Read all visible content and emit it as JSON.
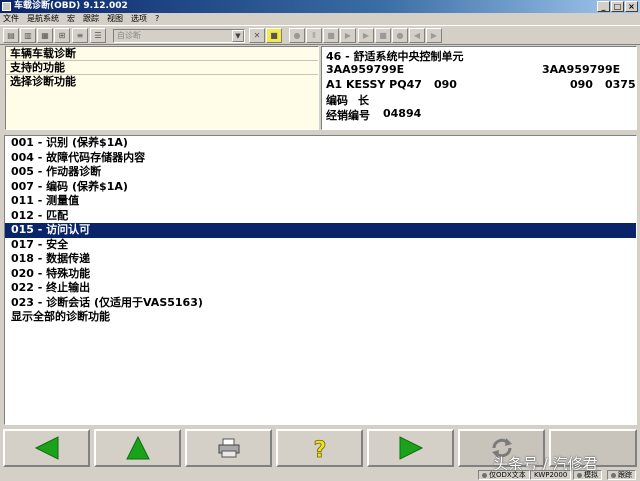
{
  "window": {
    "title": "车载诊断(OBD) 9.12.002"
  },
  "menu": [
    "文件",
    "是航系统",
    "宏",
    "跟踪",
    "视图",
    "选项",
    "?"
  ],
  "toolbar": {
    "combo_value": "自诊断"
  },
  "nav": {
    "items": [
      {
        "label": "车辆车载诊断"
      },
      {
        "label": "支持的功能"
      },
      {
        "label": "选择诊断功能"
      }
    ]
  },
  "ecu_info": {
    "title": "46 - 舒适系统中央控制单元",
    "part_left": "3AA959799E",
    "part_right": "3AA959799E",
    "component": "A1 KESSY PQ47",
    "sw_left": "090",
    "sw_mid": "090",
    "sw_right": "0375",
    "coding_label": "编码",
    "coding_value": "长",
    "dealer_label": "经销编号",
    "dealer_value": "04894"
  },
  "functions": [
    {
      "label": "001 - 识别 (保养$1A)",
      "selected": false
    },
    {
      "label": "004 - 故障代码存储器内容",
      "selected": false
    },
    {
      "label": "005 - 作动器诊断",
      "selected": false
    },
    {
      "label": "007 - 编码 (保养$1A)",
      "selected": false
    },
    {
      "label": "011 - 测量值",
      "selected": false
    },
    {
      "label": "012 - 匹配",
      "selected": false
    },
    {
      "label": "015 - 访问认可",
      "selected": true
    },
    {
      "label": "017 - 安全",
      "selected": false
    },
    {
      "label": "018 - 数据传递",
      "selected": false
    },
    {
      "label": "020 - 特殊功能",
      "selected": false
    },
    {
      "label": "022 - 终止输出",
      "selected": false
    },
    {
      "label": "023 - 诊断会话 (仅适用于VAS5163)",
      "selected": false
    },
    {
      "label": "显示全部的诊断功能",
      "selected": false
    }
  ],
  "statusbar": {
    "mode": "仅ODX文本",
    "protocol": "KWP2000",
    "sim": "模拟",
    "trace": "跟踪"
  },
  "watermark": "头条号 / 汽修君",
  "colors": {
    "nav_arrow": "#1aa31a",
    "help": "#f2e318",
    "selection": "#0a246a"
  }
}
